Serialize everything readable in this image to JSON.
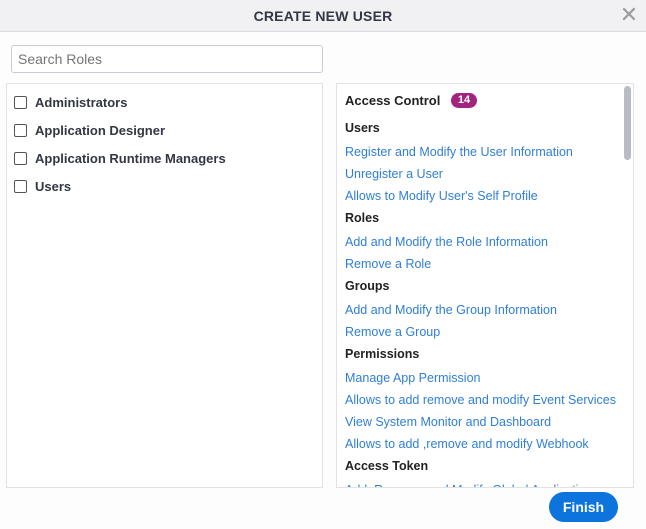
{
  "dialog": {
    "title": "CREATE NEW USER",
    "close_icon": "close-icon"
  },
  "search": {
    "placeholder": "Search Roles",
    "value": ""
  },
  "roles": [
    {
      "label": "Administrators",
      "checked": false
    },
    {
      "label": "Application Designer",
      "checked": false
    },
    {
      "label": "Application Runtime Managers",
      "checked": false
    },
    {
      "label": "Users",
      "checked": false
    }
  ],
  "permissions": {
    "title": "Access Control",
    "count": "14",
    "badge_color": "#a3247e",
    "items": [
      {
        "type": "head",
        "text": "Users"
      },
      {
        "type": "link",
        "text": "Register and Modify the User Information"
      },
      {
        "type": "link",
        "text": "Unregister a User"
      },
      {
        "type": "link",
        "text": "Allows to Modify User's Self Profile"
      },
      {
        "type": "head",
        "text": "Roles"
      },
      {
        "type": "link",
        "text": "Add and Modify the Role Information"
      },
      {
        "type": "link",
        "text": "Remove a Role"
      },
      {
        "type": "head",
        "text": "Groups"
      },
      {
        "type": "link",
        "text": "Add and Modify the Group Information"
      },
      {
        "type": "link",
        "text": "Remove a Group"
      },
      {
        "type": "head",
        "text": "Permissions"
      },
      {
        "type": "link",
        "text": "Manage App Permission"
      },
      {
        "type": "link",
        "text": "Allows to add remove and modify Event Services"
      },
      {
        "type": "link",
        "text": "View System Monitor and Dashboard"
      },
      {
        "type": "link",
        "text": "Allows to add ,remove and modify Webhook"
      },
      {
        "type": "head",
        "text": "Access Token"
      },
      {
        "type": "link",
        "text": "Add, Remove, and Modify Global Application"
      }
    ]
  },
  "footer": {
    "finish_label": "Finish",
    "accent_color": "#0d74dd"
  }
}
